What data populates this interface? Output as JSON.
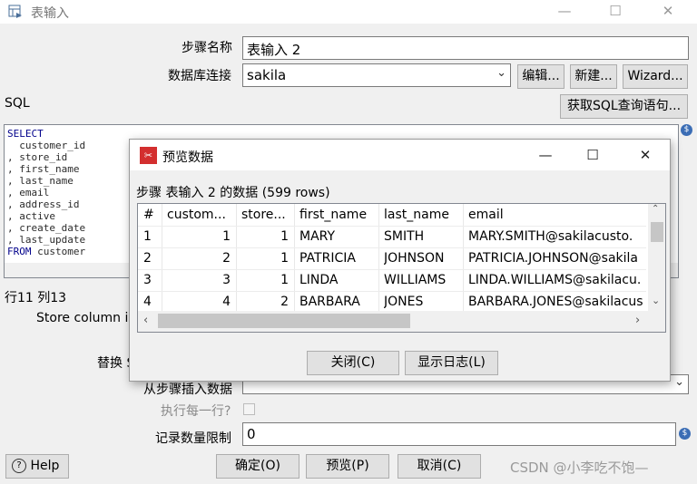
{
  "window": {
    "title": "表输入",
    "controls": [
      "—",
      "☐",
      "✕"
    ]
  },
  "form": {
    "step_name_label": "步骤名称",
    "step_name_value": "表输入 2",
    "db_conn_label": "数据库连接",
    "db_conn_value": "sakila",
    "edit_button": "编辑...",
    "new_button": "新建...",
    "wizard_button": "Wizard...",
    "sql_label": "SQL",
    "get_sql_button": "获取SQL查询语句...",
    "sql_lines": [
      {
        "kw": "SELECT",
        "text": ""
      },
      {
        "kw": "",
        "text": "  customer_id"
      },
      {
        "kw": "",
        "text": ", store_id"
      },
      {
        "kw": "",
        "text": ", first_name"
      },
      {
        "kw": "",
        "text": ", last_name"
      },
      {
        "kw": "",
        "text": ", email"
      },
      {
        "kw": "",
        "text": ", address_id"
      },
      {
        "kw": "",
        "text": ", active"
      },
      {
        "kw": "",
        "text": ", create_date"
      },
      {
        "kw": "",
        "text": ", last_update"
      },
      {
        "kw": "FROM",
        "text": " customer"
      }
    ],
    "cursor_pos": "行11 列13",
    "store_column_label": "Store column i",
    "replace_label": "替换 S",
    "insert_from_step_label": "从步骤插入数据",
    "exec_each_row_label": "执行每一行?",
    "limit_label": "记录数量限制",
    "limit_value": "0",
    "help_button": "Help",
    "ok_button": "确定(O)",
    "preview_button": "预览(P)",
    "cancel_button": "取消(C)",
    "watermark": "CSDN @小李吃不饱—"
  },
  "dialog": {
    "title": "预览数据",
    "controls": [
      "—",
      "☐",
      "✕"
    ],
    "summary": "步骤 表输入 2 的数据  (599 rows)",
    "columns": [
      "#",
      "custom...",
      "store...",
      "first_name",
      "last_name",
      "email"
    ],
    "rows": [
      [
        "1",
        "1",
        "1",
        "MARY",
        "SMITH",
        "MARY.SMITH@sakilacusto."
      ],
      [
        "2",
        "2",
        "1",
        "PATRICIA",
        "JOHNSON",
        "PATRICIA.JOHNSON@sakila"
      ],
      [
        "3",
        "3",
        "1",
        "LINDA",
        "WILLIAMS",
        "LINDA.WILLIAMS@sakilacu."
      ],
      [
        "4",
        "4",
        "2",
        "BARBARA",
        "JONES",
        "BARBARA.JONES@sakilacus"
      ]
    ],
    "close_button": "关闭(C)",
    "log_button": "显示日志(L)"
  }
}
